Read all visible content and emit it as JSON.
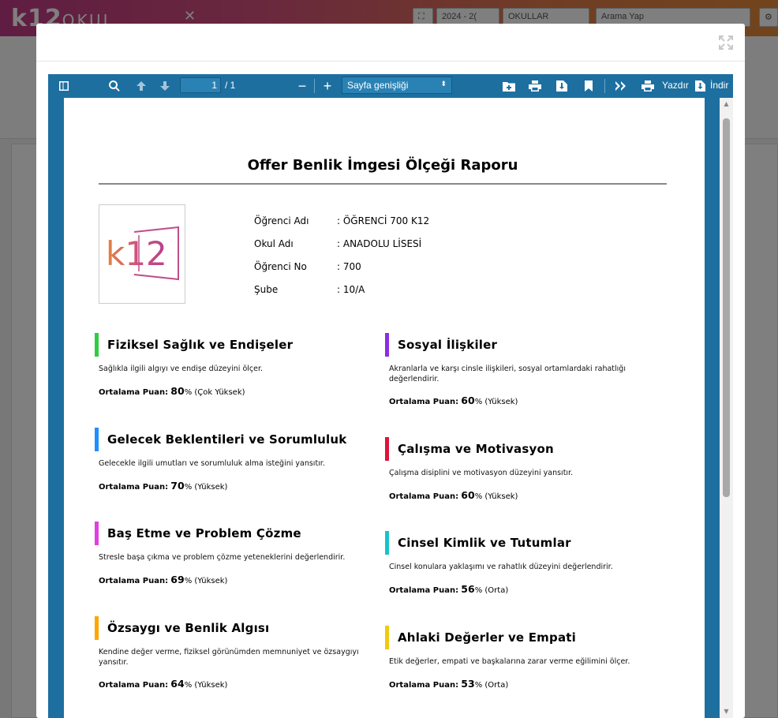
{
  "app": {
    "logo_main": "k12",
    "logo_sub": "OKUL",
    "year_select": "2024 - 2(",
    "school_select": "OKULLAR",
    "search_placeholder": "Arama Yap"
  },
  "viewer": {
    "page_current": "1",
    "page_total": "/ 1",
    "zoom": "Sayfa genişliği",
    "print_label": "Yazdır",
    "download_label": "İndir"
  },
  "report": {
    "title": "Offer Benlik İmgesi Ölçeği Raporu",
    "logo_text": "k12",
    "info": [
      {
        "label": "Öğrenci Adı",
        "value": ": ÖĞRENCİ 700 K12"
      },
      {
        "label": "Okul Adı",
        "value": ": ANADOLU LİSESİ"
      },
      {
        "label": "Öğrenci No",
        "value": ": 700"
      },
      {
        "label": "Şube",
        "value": ": 10/A"
      }
    ],
    "score_label": "Ortalama Puan:",
    "sections": [
      {
        "title": "Fiziksel Sağlık ve Endişeler",
        "desc": "Sağlıkla ilgili algıyı ve endişe düzeyini ölçer.",
        "score": "80",
        "level": "(Çok Yüksek)",
        "color": "#2ecc40"
      },
      {
        "title": "Sosyal İlişkiler",
        "desc": "Akranlarla ve karşı cinsle ilişkileri, sosyal ortamlardaki rahatlığı değerlendirir.",
        "score": "60",
        "level": "(Yüksek)",
        "color": "#8e2de2"
      },
      {
        "title": "Gelecek Beklentileri ve Sorumluluk",
        "desc": "Gelecekle ilgili umutları ve sorumluluk alma isteğini yansıtır.",
        "score": "70",
        "level": "(Yüksek)",
        "color": "#1e8fff"
      },
      {
        "title": "Çalışma ve Motivasyon",
        "desc": "Çalışma disiplini ve motivasyon düzeyini yansıtır.",
        "score": "60",
        "level": "(Yüksek)",
        "color": "#dc143c"
      },
      {
        "title": "Baş Etme ve Problem Çözme",
        "desc": "Stresle başa çıkma ve problem çözme yeteneklerini değerlendirir.",
        "score": "69",
        "level": "(Yüksek)",
        "color": "#e040e0"
      },
      {
        "title": "Cinsel Kimlik ve Tutumlar",
        "desc": "Cinsel konulara yaklaşımı ve rahatlık düzeyini değerlendirir.",
        "score": "56",
        "level": "(Orta)",
        "color": "#17c3c9"
      },
      {
        "title": "Özsaygı ve Benlik Algısı",
        "desc": "Kendine değer verme, fiziksel görünümden memnuniyet ve özsaygıyı yansıtır.",
        "score": "64",
        "level": "(Yüksek)",
        "color": "#ffa500"
      },
      {
        "title": "Ahlaki Değerler ve Empati",
        "desc": "Etik değerler, empati ve başkalarına zarar verme eğilimini ölçer.",
        "score": "53",
        "level": "(Orta)",
        "color": "#f2c811"
      }
    ]
  }
}
